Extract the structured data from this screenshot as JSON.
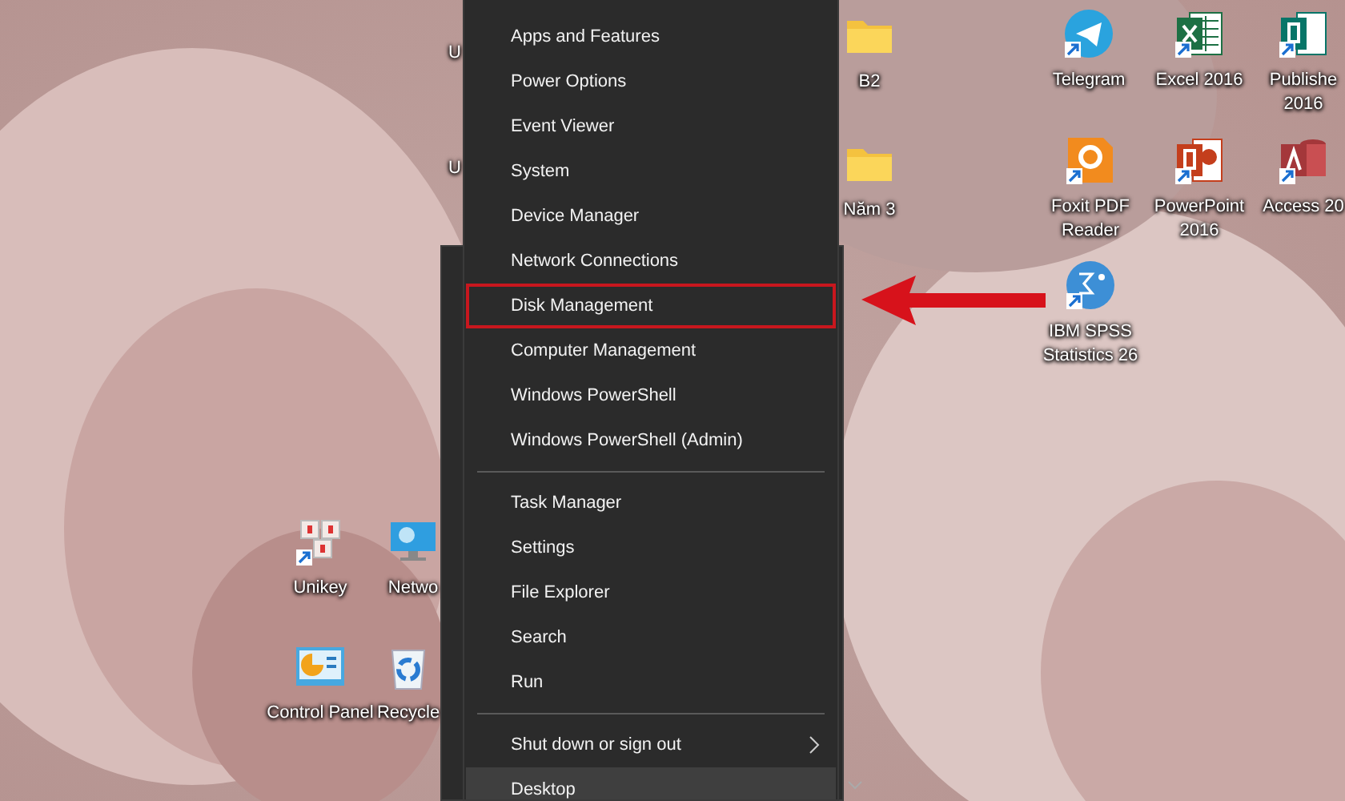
{
  "desktop_icons": [
    {
      "label": "U",
      "kind": "cut"
    },
    {
      "label": "B2",
      "kind": "folder"
    },
    {
      "label": "Telegram",
      "kind": "telegram"
    },
    {
      "label": "Excel 2016",
      "kind": "excel"
    },
    {
      "label": "Publishe 2016",
      "kind": "publisher"
    },
    {
      "label": "U",
      "kind": "cut"
    },
    {
      "label": "Năm 3",
      "kind": "folder"
    },
    {
      "label": "Foxit PDF Reader",
      "kind": "foxit"
    },
    {
      "label": "PowerPoint 2016",
      "kind": "powerpoint"
    },
    {
      "label": "Access 20",
      "kind": "access"
    },
    {
      "label": "IBM SPSS Statistics 26",
      "kind": "spss"
    },
    {
      "label": "Unikey",
      "kind": "unikey"
    },
    {
      "label": "Netwo",
      "kind": "network"
    },
    {
      "label": "Control Panel",
      "kind": "control-panel"
    },
    {
      "label": "Recycle",
      "kind": "recycle-bin"
    }
  ],
  "menu": {
    "groups": [
      [
        {
          "label": "Apps and Features",
          "selected": false,
          "outlined": false,
          "submenu": false
        },
        {
          "label": "Power Options",
          "selected": false,
          "outlined": false,
          "submenu": false
        },
        {
          "label": "Event Viewer",
          "selected": false,
          "outlined": false,
          "submenu": false
        },
        {
          "label": "System",
          "selected": false,
          "outlined": false,
          "submenu": false
        },
        {
          "label": "Device Manager",
          "selected": false,
          "outlined": false,
          "submenu": false
        },
        {
          "label": "Network Connections",
          "selected": false,
          "outlined": false,
          "submenu": false
        },
        {
          "label": "Disk Management",
          "selected": false,
          "outlined": true,
          "submenu": false
        },
        {
          "label": "Computer Management",
          "selected": false,
          "outlined": false,
          "submenu": false
        },
        {
          "label": "Windows PowerShell",
          "selected": false,
          "outlined": false,
          "submenu": false
        },
        {
          "label": "Windows PowerShell (Admin)",
          "selected": false,
          "outlined": false,
          "submenu": false
        }
      ],
      [
        {
          "label": "Task Manager",
          "selected": false,
          "outlined": false,
          "submenu": false
        },
        {
          "label": "Settings",
          "selected": false,
          "outlined": false,
          "submenu": false
        },
        {
          "label": "File Explorer",
          "selected": false,
          "outlined": false,
          "submenu": false
        },
        {
          "label": "Search",
          "selected": false,
          "outlined": false,
          "submenu": false
        },
        {
          "label": "Run",
          "selected": false,
          "outlined": false,
          "submenu": false
        }
      ],
      [
        {
          "label": "Shut down or sign out",
          "selected": false,
          "outlined": false,
          "submenu": true
        },
        {
          "label": "Desktop",
          "selected": true,
          "outlined": false,
          "submenu": false
        }
      ]
    ]
  }
}
